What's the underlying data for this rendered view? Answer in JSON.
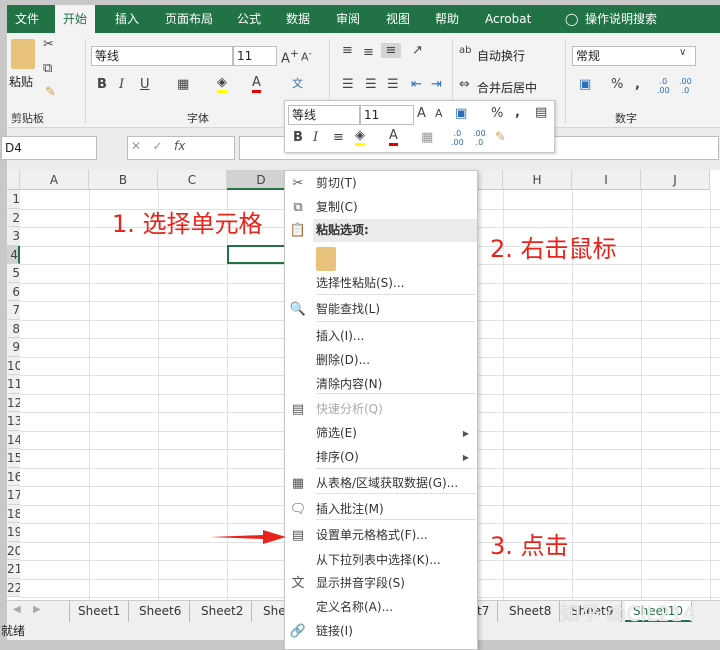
{
  "ribbon_tabs": [
    "文件",
    "开始",
    "插入",
    "页面布局",
    "公式",
    "数据",
    "审阅",
    "视图",
    "帮助",
    "Acrobat"
  ],
  "active_tab": "开始",
  "tell_me": "操作说明搜索",
  "clipboard": {
    "paste": "粘贴",
    "label": "剪贴板"
  },
  "font": {
    "name": "等线",
    "size": "11",
    "label": "字体"
  },
  "alignment": {
    "wrap": "自动换行",
    "merge": "合并后居中"
  },
  "number": {
    "format": "常规",
    "label": "数字"
  },
  "mini_toolbar": {
    "font": "等线",
    "size": "11"
  },
  "name_box": "D4",
  "fx": "fx",
  "columns": [
    "A",
    "B",
    "C",
    "D",
    "E",
    "F",
    "G",
    "H",
    "I",
    "J"
  ],
  "rows": [
    "1",
    "2",
    "3",
    "4",
    "5",
    "6",
    "7",
    "8",
    "9",
    "10",
    "11",
    "12",
    "13",
    "14",
    "15",
    "16",
    "17",
    "18",
    "19",
    "20",
    "21",
    "22"
  ],
  "selected_cell": "D4",
  "context_menu": [
    {
      "label": "剪切(T)",
      "icon": "scissors"
    },
    {
      "label": "复制(C)",
      "icon": "copy"
    },
    {
      "label": "粘贴选项:",
      "icon": "paste",
      "header": true
    },
    {
      "label": "",
      "icon": "paste-big"
    },
    {
      "label": "选择性粘贴(S)...",
      "icon": ""
    },
    {
      "label": "智能查找(L)",
      "icon": "smart-lookup"
    },
    {
      "label": "插入(I)...",
      "icon": ""
    },
    {
      "label": "删除(D)...",
      "icon": ""
    },
    {
      "label": "清除内容(N)",
      "icon": ""
    },
    {
      "label": "快速分析(Q)",
      "icon": "quick-analysis",
      "disabled": true
    },
    {
      "label": "筛选(E)",
      "icon": "",
      "submenu": true
    },
    {
      "label": "排序(O)",
      "icon": "",
      "submenu": true
    },
    {
      "label": "从表格/区域获取数据(G)...",
      "icon": "table"
    },
    {
      "label": "插入批注(M)",
      "icon": "comment"
    },
    {
      "label": "设置单元格格式(F)...",
      "icon": "format-cells"
    },
    {
      "label": "从下拉列表中选择(K)...",
      "icon": ""
    },
    {
      "label": "显示拼音字段(S)",
      "icon": "phonetic"
    },
    {
      "label": "定义名称(A)...",
      "icon": ""
    },
    {
      "label": "链接(I)",
      "icon": "link"
    }
  ],
  "sheets": [
    "Sheet1",
    "Sheet6",
    "Sheet2",
    "Sheet3",
    "Sheet7",
    "Sheet8",
    "Sheet9",
    "Sheet10"
  ],
  "active_sheet": "Sheet10",
  "status": "就绪",
  "annotations": {
    "step1": "1. 选择单元格",
    "step2": "2. 右击鼠标",
    "step3": "3. 点击"
  },
  "watermark": "知乎 @CIL214",
  "colors": {
    "accent": "#217346",
    "annotation": "#e8231c"
  }
}
